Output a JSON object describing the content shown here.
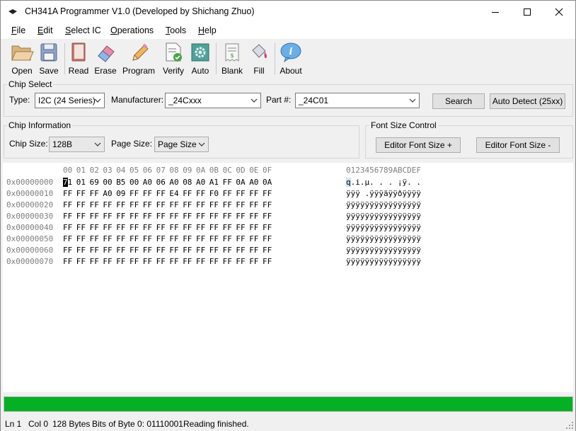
{
  "window": {
    "title": "CH341A Programmer V1.0 (Developed by Shichang Zhuo)"
  },
  "menu": [
    {
      "ul": "F",
      "rest": "ile"
    },
    {
      "ul": "E",
      "rest": "dit"
    },
    {
      "ul": "S",
      "rest": "elect IC"
    },
    {
      "ul": "O",
      "rest": "perations"
    },
    {
      "ul": "T",
      "rest": "ools"
    },
    {
      "ul": "H",
      "rest": "elp"
    }
  ],
  "toolbar": {
    "open": "Open",
    "save": "Save",
    "read": "Read",
    "erase": "Erase",
    "program": "Program",
    "verify": "Verify",
    "auto": "Auto",
    "blank": "Blank",
    "fill": "Fill",
    "about": "About"
  },
  "chip_select": {
    "title": "Chip Select",
    "type_label": "Type:",
    "type_value": "I2C (24 Series)",
    "manufacturer_label": "Manufacturer:",
    "manufacturer_value": "_24Cxxx",
    "part_label": "Part #:",
    "part_value": "_24C01",
    "search_button": "Search",
    "auto_detect_button": "Auto Detect (25xx)"
  },
  "chip_info": {
    "title": "Chip Information",
    "size_label": "Chip Size:",
    "size_value": "128B",
    "page_label": "Page Size:",
    "page_value": "Page Size"
  },
  "font_size": {
    "title": "Font Size Control",
    "plus_button": "Editor Font Size +",
    "minus_button": "Editor Font Size -"
  },
  "hex": {
    "columns": [
      "00",
      "01",
      "02",
      "03",
      "04",
      "05",
      "06",
      "07",
      "08",
      "09",
      "0A",
      "0B",
      "0C",
      "0D",
      "0E",
      "0F"
    ],
    "ascii_header": "0123456789ABCDEF",
    "rows": [
      {
        "offset": "0x00000000",
        "bytes": [
          "71",
          "01",
          "69",
          "00",
          "B5",
          "00",
          "A0",
          "06",
          "A0",
          "08",
          "A0",
          "A1",
          "FF",
          "0A",
          "A0",
          "0A"
        ],
        "ascii": "q.i.µ. . . ¡ÿ. ."
      },
      {
        "offset": "0x00000010",
        "bytes": [
          "FF",
          "FF",
          "FF",
          "A0",
          "09",
          "FF",
          "FF",
          "FF",
          "E4",
          "FF",
          "FF",
          "F0",
          "FF",
          "FF",
          "FF",
          "FF"
        ],
        "ascii": "ÿÿÿ .ÿÿÿäÿÿðÿÿÿÿ"
      },
      {
        "offset": "0x00000020",
        "bytes": [
          "FF",
          "FF",
          "FF",
          "FF",
          "FF",
          "FF",
          "FF",
          "FF",
          "FF",
          "FF",
          "FF",
          "FF",
          "FF",
          "FF",
          "FF",
          "FF"
        ],
        "ascii": "ÿÿÿÿÿÿÿÿÿÿÿÿÿÿÿÿ"
      },
      {
        "offset": "0x00000030",
        "bytes": [
          "FF",
          "FF",
          "FF",
          "FF",
          "FF",
          "FF",
          "FF",
          "FF",
          "FF",
          "FF",
          "FF",
          "FF",
          "FF",
          "FF",
          "FF",
          "FF"
        ],
        "ascii": "ÿÿÿÿÿÿÿÿÿÿÿÿÿÿÿÿ"
      },
      {
        "offset": "0x00000040",
        "bytes": [
          "FF",
          "FF",
          "FF",
          "FF",
          "FF",
          "FF",
          "FF",
          "FF",
          "FF",
          "FF",
          "FF",
          "FF",
          "FF",
          "FF",
          "FF",
          "FF"
        ],
        "ascii": "ÿÿÿÿÿÿÿÿÿÿÿÿÿÿÿÿ"
      },
      {
        "offset": "0x00000050",
        "bytes": [
          "FF",
          "FF",
          "FF",
          "FF",
          "FF",
          "FF",
          "FF",
          "FF",
          "FF",
          "FF",
          "FF",
          "FF",
          "FF",
          "FF",
          "FF",
          "FF"
        ],
        "ascii": "ÿÿÿÿÿÿÿÿÿÿÿÿÿÿÿÿ"
      },
      {
        "offset": "0x00000060",
        "bytes": [
          "FF",
          "FF",
          "FF",
          "FF",
          "FF",
          "FF",
          "FF",
          "FF",
          "FF",
          "FF",
          "FF",
          "FF",
          "FF",
          "FF",
          "FF",
          "FF"
        ],
        "ascii": "ÿÿÿÿÿÿÿÿÿÿÿÿÿÿÿÿ"
      },
      {
        "offset": "0x00000070",
        "bytes": [
          "FF",
          "FF",
          "FF",
          "FF",
          "FF",
          "FF",
          "FF",
          "FF",
          "FF",
          "FF",
          "FF",
          "FF",
          "FF",
          "FF",
          "FF",
          "FF"
        ],
        "ascii": "ÿÿÿÿÿÿÿÿÿÿÿÿÿÿÿÿ"
      }
    ]
  },
  "progress": {
    "fraction": 1.0,
    "color": "#06b025"
  },
  "status": {
    "line": "Ln 1",
    "col": "Col 0",
    "size": "128 Bytes",
    "bits": "Bits of Byte 0: 01110001",
    "message": "Reading finished."
  }
}
